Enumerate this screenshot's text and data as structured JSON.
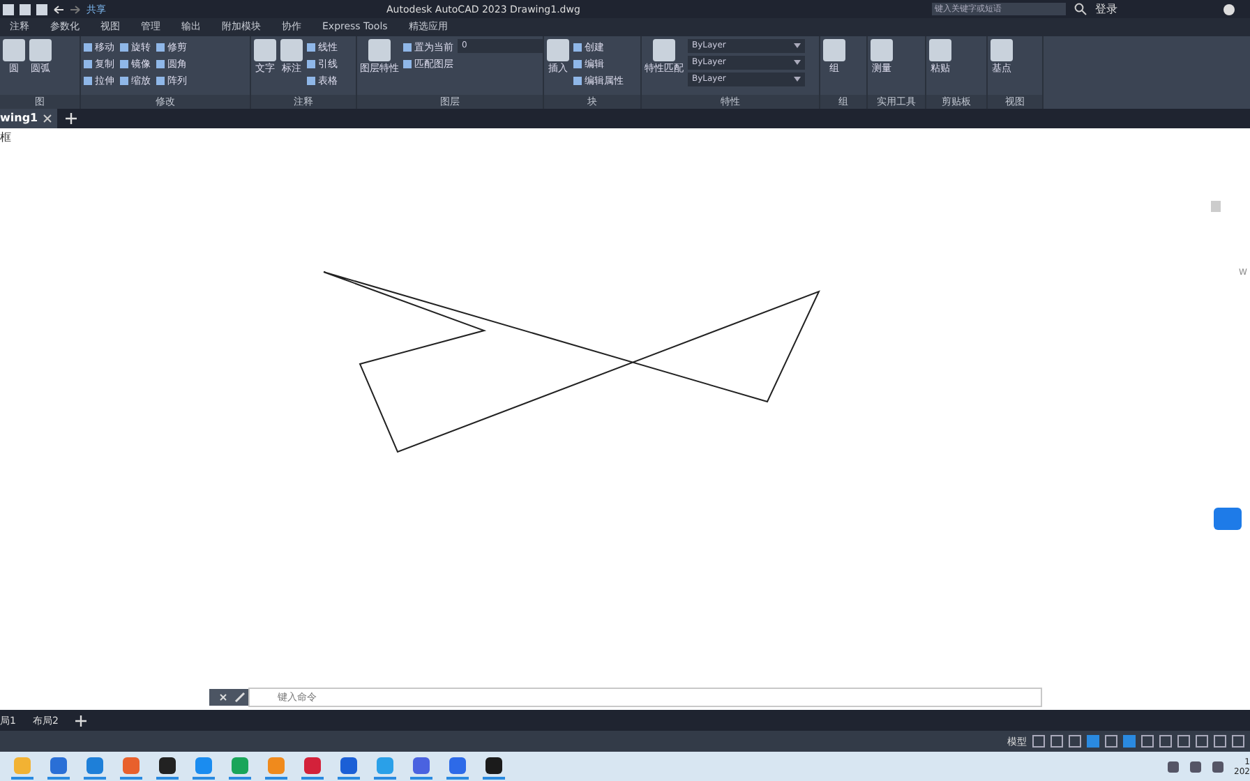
{
  "title_bar": {
    "share": "共享",
    "title": "Autodesk AutoCAD 2023    Drawing1.dwg",
    "search": {
      "placeholder": "键入关键字或短语"
    },
    "sign_in": "登录"
  },
  "ribbon_tabs": [
    {
      "label": "注释",
      "selected": false
    },
    {
      "label": "参数化",
      "selected": false
    },
    {
      "label": "视图",
      "selected": false
    },
    {
      "label": "管理",
      "selected": false
    },
    {
      "label": "输出",
      "selected": false
    },
    {
      "label": "附加模块",
      "selected": false
    },
    {
      "label": "协作",
      "selected": false
    },
    {
      "label": "Express Tools",
      "selected": false
    },
    {
      "label": "精选应用",
      "selected": false
    }
  ],
  "ribbon_panels": [
    {
      "title": "图",
      "large": [
        "圆",
        "圆弧"
      ]
    },
    {
      "title": "修改",
      "small": [
        "移动",
        "复制",
        "拉伸",
        "旋转",
        "镜像",
        "缩放",
        "修剪",
        "圆角",
        "阵列"
      ]
    },
    {
      "title": "注释",
      "large": [
        "文字",
        "标注"
      ],
      "small": [
        "线性",
        "引线",
        "表格"
      ]
    },
    {
      "title": "图层",
      "large": [
        "图层特性"
      ],
      "small": [
        "置为当前",
        "匹配图层"
      ],
      "dropdowns": [
        "0"
      ]
    },
    {
      "title": "块",
      "large": [
        "插入"
      ],
      "small": [
        "创建",
        "编辑",
        "编辑属性"
      ]
    },
    {
      "title": "特性",
      "large": [
        "特性匹配"
      ],
      "dropdowns": [
        "ByLayer",
        "ByLayer",
        "ByLayer"
      ]
    },
    {
      "title": "组",
      "large": [
        "组"
      ]
    },
    {
      "title": "实用工具",
      "large": [
        "测量"
      ]
    },
    {
      "title": "剪贴板",
      "large": [
        "粘贴"
      ]
    },
    {
      "title": "视图",
      "large": [
        "基点"
      ]
    }
  ],
  "document_tabs": [
    {
      "label": "wing1",
      "selected": true
    }
  ],
  "canvas": {
    "viewport_label": "框",
    "viewcube_label": "W"
  },
  "command_line": {
    "placeholder": "键入命令"
  },
  "layout_tabs": [
    {
      "label": "局1",
      "selected": false
    },
    {
      "label": "布局2",
      "selected": false
    }
  ],
  "status_bar": {
    "mode": "模型",
    "toggles": [
      {
        "on": false
      },
      {
        "on": false
      },
      {
        "on": false
      },
      {
        "on": true
      },
      {
        "on": false
      },
      {
        "on": true
      },
      {
        "on": false
      },
      {
        "on": false
      },
      {
        "on": false
      },
      {
        "on": false
      },
      {
        "on": false
      },
      {
        "on": false
      }
    ]
  },
  "taskbar": {
    "apps": [
      {
        "color": "#f2b233",
        "running": true
      },
      {
        "color": "#2a6fd6",
        "running": true
      },
      {
        "color": "#1e7fd8",
        "running": true
      },
      {
        "color": "#e8602c",
        "running": true
      },
      {
        "color": "#222222",
        "running": true
      },
      {
        "color": "#1a8cf0",
        "running": true
      },
      {
        "color": "#19a55a",
        "running": true
      },
      {
        "color": "#f08a1c",
        "running": true
      },
      {
        "color": "#d3213a",
        "running": true
      },
      {
        "color": "#1b5fd6",
        "running": true
      },
      {
        "color": "#2aa0e8",
        "running": true
      },
      {
        "color": "#4a62e0",
        "running": true
      },
      {
        "color": "#2d6ae8",
        "running": true
      },
      {
        "color": "#1b1b1b",
        "running": true
      }
    ],
    "clock": [
      "1",
      "202"
    ]
  }
}
